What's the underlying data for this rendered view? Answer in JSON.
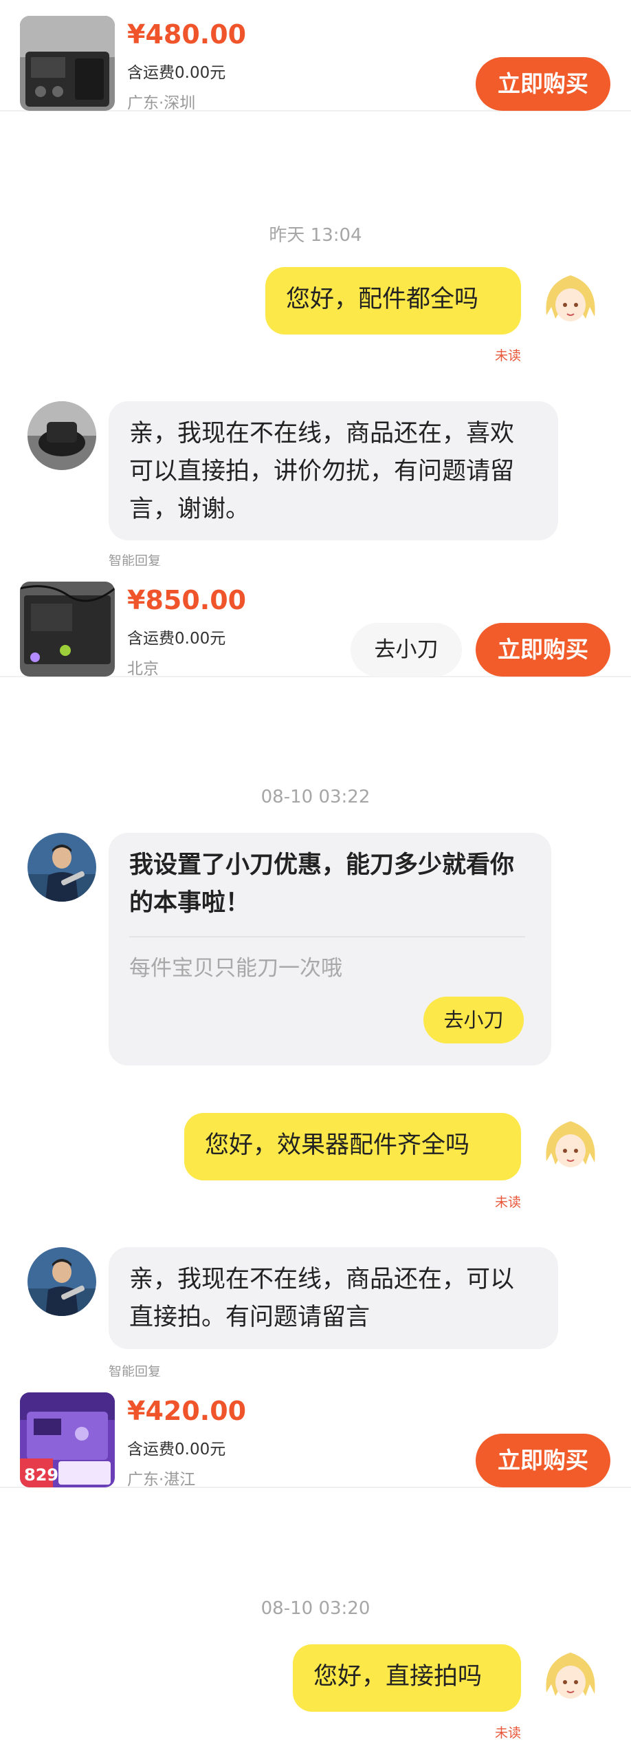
{
  "products": [
    {
      "price": "¥480.00",
      "shipping": "含运费0.00元",
      "location": "广东·深圳",
      "buy_label": "立即购买"
    },
    {
      "price": "¥850.00",
      "shipping": "含运费0.00元",
      "location": "北京",
      "buy_label": "立即购买",
      "bargain_label": "去小刀"
    },
    {
      "price": "¥420.00",
      "shipping": "含运费0.00元",
      "location": "广东·湛江",
      "buy_label": "立即购买",
      "thumb_badge": "829"
    }
  ],
  "timestamps": [
    "昨天 13:04",
    "08-10 03:22",
    "08-10 03:20"
  ],
  "messages": {
    "m1": "您好，配件都全吗",
    "m2": "亲，我现在不在线，商品还在，喜欢可以直接拍，讲价勿扰，有问题请留言，谢谢。",
    "m3": "您好，效果器配件齐全吗",
    "m4": "亲，我现在不在线，商品还在，可以直接拍。有问题请留言",
    "m5": "您好，直接拍吗"
  },
  "status": {
    "unread": "未读",
    "smart_reply": "智能回复"
  },
  "coupon": {
    "title": "我设置了小刀优惠，能刀多少就看你的本事啦！",
    "subtitle": "每件宝贝只能刀一次哦",
    "button_label": "去小刀"
  },
  "colors": {
    "accent": "#f25b2a",
    "price": "#f0542b",
    "my_bubble": "#fde84a",
    "their_bubble": "#f2f2f4",
    "unread": "#e8573a"
  }
}
